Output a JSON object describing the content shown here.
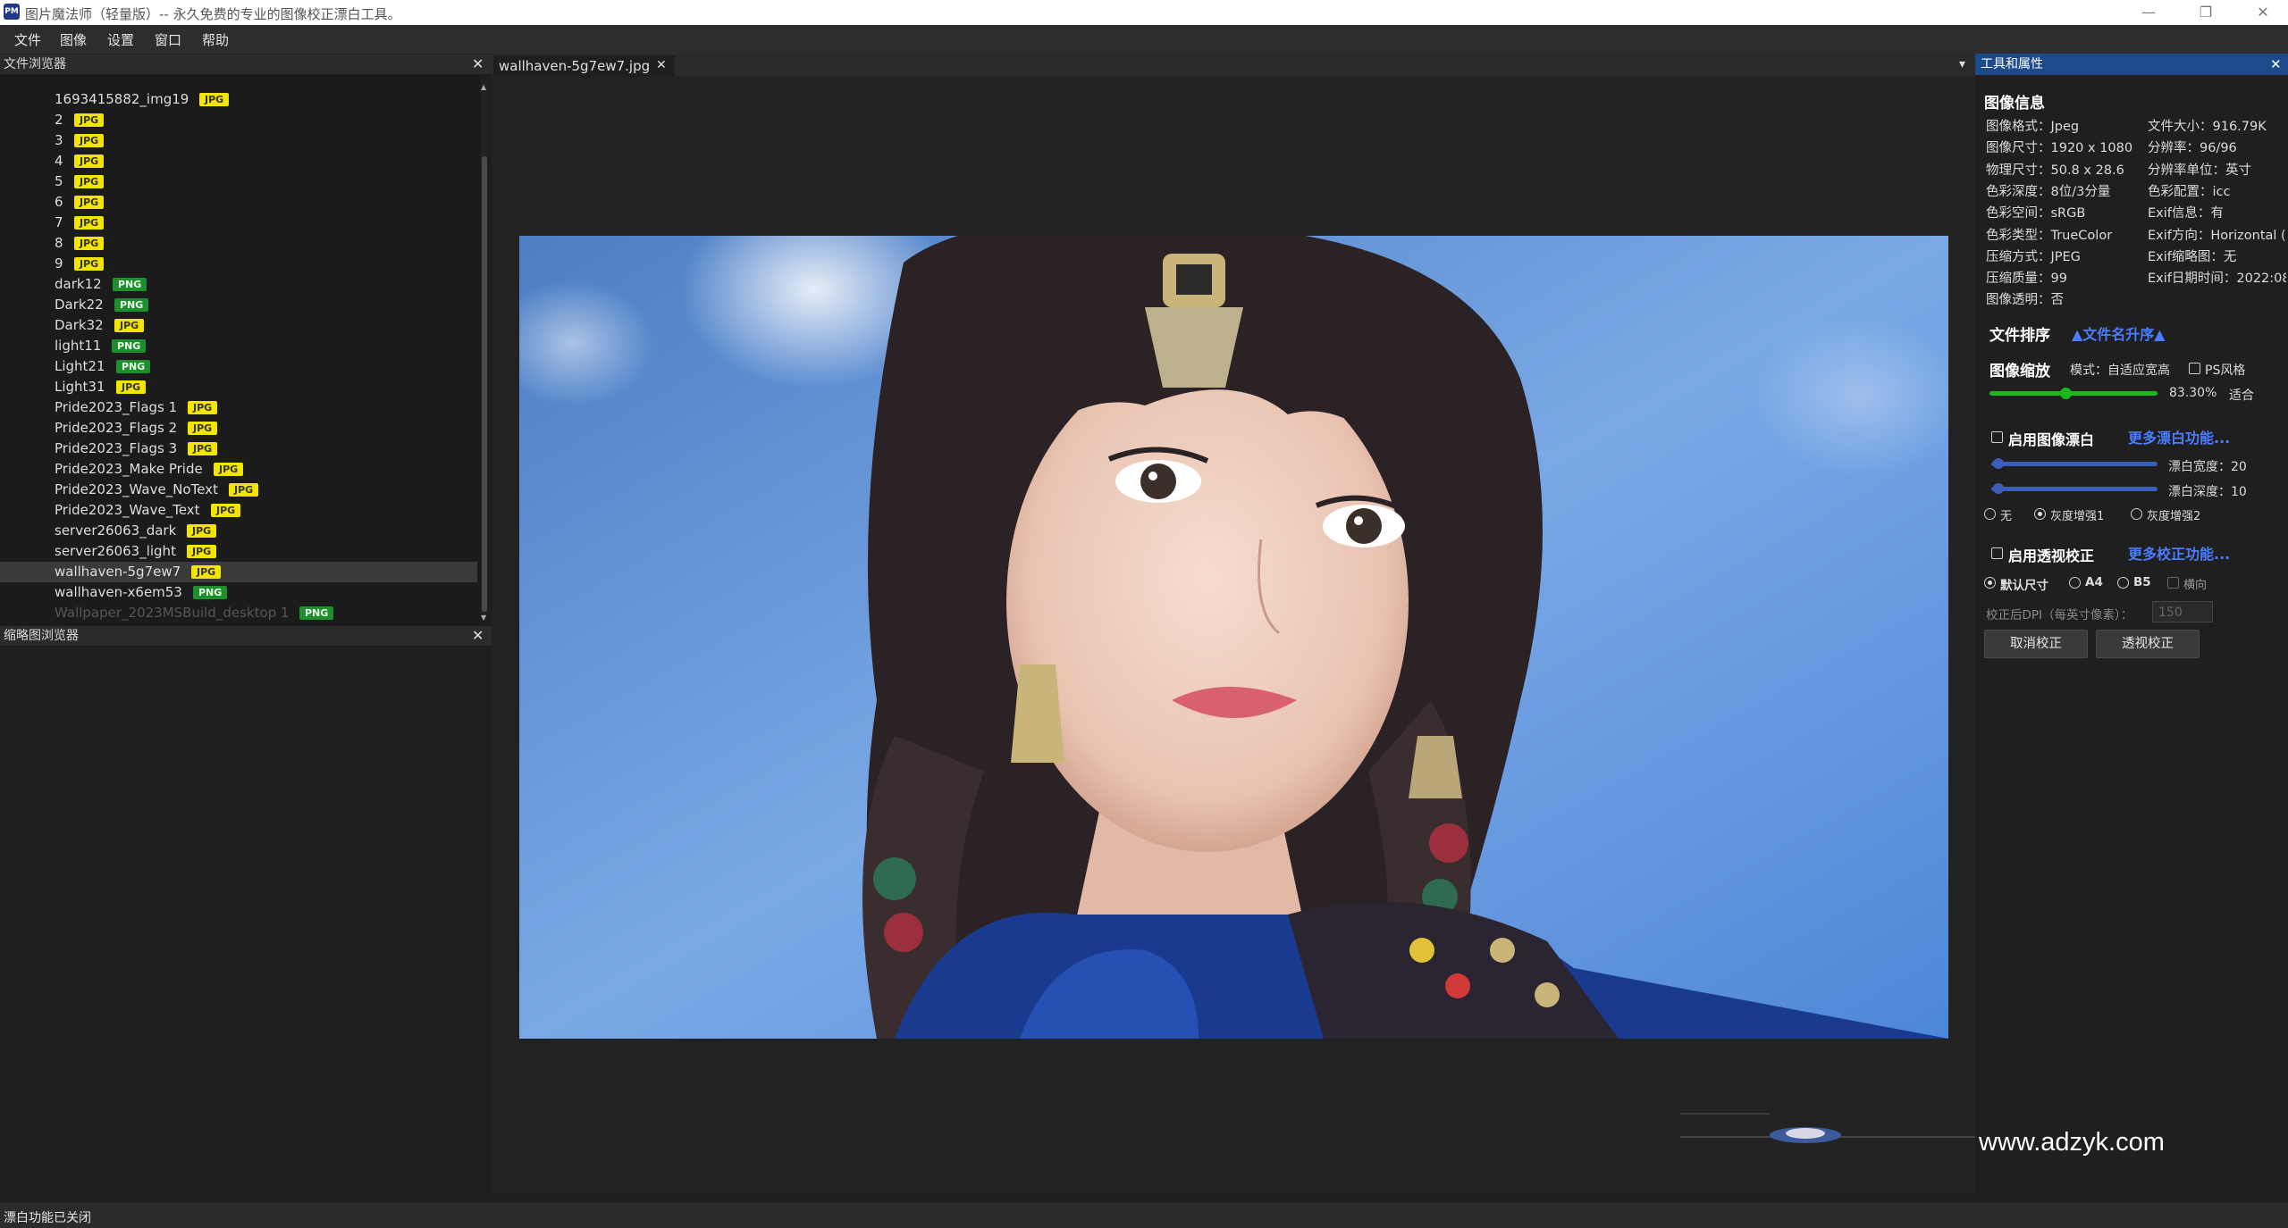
{
  "window": {
    "title": "图片魔法师（轻量版）-- 永久免费的专业的图像校正漂白工具。",
    "minimize": "—",
    "maximize": "❐",
    "close": "✕"
  },
  "menu": [
    "文件",
    "图像",
    "设置",
    "窗口",
    "帮助"
  ],
  "file_browser": {
    "title": "文件浏览器",
    "close": "✕",
    "files": [
      {
        "name": "1693415882_img19",
        "type": "JPG"
      },
      {
        "name": "2",
        "type": "JPG"
      },
      {
        "name": "3",
        "type": "JPG"
      },
      {
        "name": "4",
        "type": "JPG"
      },
      {
        "name": "5",
        "type": "JPG"
      },
      {
        "name": "6",
        "type": "JPG"
      },
      {
        "name": "7",
        "type": "JPG"
      },
      {
        "name": "8",
        "type": "JPG"
      },
      {
        "name": "9",
        "type": "JPG"
      },
      {
        "name": "dark12",
        "type": "PNG"
      },
      {
        "name": "Dark22",
        "type": "PNG"
      },
      {
        "name": "Dark32",
        "type": "JPG"
      },
      {
        "name": "light11",
        "type": "PNG"
      },
      {
        "name": "Light21",
        "type": "PNG"
      },
      {
        "name": "Light31",
        "type": "JPG"
      },
      {
        "name": "Pride2023_Flags 1",
        "type": "JPG"
      },
      {
        "name": "Pride2023_Flags 2",
        "type": "JPG"
      },
      {
        "name": "Pride2023_Flags 3",
        "type": "JPG"
      },
      {
        "name": "Pride2023_Make Pride",
        "type": "JPG"
      },
      {
        "name": "Pride2023_Wave_NoText",
        "type": "JPG"
      },
      {
        "name": "Pride2023_Wave_Text",
        "type": "JPG"
      },
      {
        "name": "server26063_dark",
        "type": "JPG"
      },
      {
        "name": "server26063_light",
        "type": "JPG"
      },
      {
        "name": "wallhaven-5g7ew7",
        "type": "JPG"
      },
      {
        "name": "wallhaven-x6em53",
        "type": "PNG"
      },
      {
        "name": "Wallpaper_2023MSBuild_desktop 1",
        "type": "PNG"
      }
    ],
    "selected_index": 23
  },
  "thumbnail_browser": {
    "title": "缩略图浏览器",
    "close": "✕"
  },
  "tab": {
    "label": "wallhaven-5g7ew7.jpg",
    "close": "✕",
    "dropdown": "▾"
  },
  "props": {
    "title": "工具和属性",
    "close": "✕",
    "image_info_title": "图像信息",
    "info_left": [
      "图像格式：Jpeg",
      "图像尺寸：1920 x 1080",
      "物理尺寸：50.8 x 28.6",
      "色彩深度：8位/3分量",
      "色彩空间：sRGB",
      "色彩类型：TrueColor",
      "压缩方式：JPEG",
      "压缩质量：99",
      "图像透明：否"
    ],
    "info_right": [
      "文件大小：916.79K",
      "分辨率：96/96",
      "分辨率单位：英寸",
      "色彩配置：icc",
      "Exif信息：有",
      "Exif方向：Horizontal (",
      "Exif缩略图：无",
      "Exif日期时间：2022:08",
      ""
    ],
    "sort_title": "文件排序",
    "sort_value": "▲文件名升序▲",
    "zoom_title": "图像缩放",
    "zoom_mode": "模式：自适应宽高",
    "ps_style": "PS风格",
    "zoom_value": "83.30%",
    "zoom_fit": "适合",
    "zoom_level": 0.45,
    "whiten_enable": "启用图像漂白",
    "whiten_more": "更多漂白功能...",
    "whiten_width_label": "漂白宽度：20",
    "whiten_depth_label": "漂白深度：10",
    "whiten_width": 0.02,
    "whiten_depth": 0.02,
    "gray_options": [
      "无",
      "灰度增强1",
      "灰度增强2"
    ],
    "gray_selected": 1,
    "persp_enable": "启用透视校正",
    "persp_more": "更多校正功能...",
    "size_options": [
      "默认尺寸",
      "A4",
      "B5"
    ],
    "landscape": "横向",
    "dpi_label": "校正后DPI（每英寸像素）：",
    "dpi_value": "150",
    "cancel_btn": "取消校正",
    "persp_btn": "透视校正"
  },
  "status": "漂白功能已关闭",
  "watermark": "www.adzyk.com",
  "colors": {
    "accent": "#1d4a8a",
    "link": "#4a7dff",
    "jpg_badge": "#f2e600",
    "png_badge": "#1e8f2e",
    "slider_green": "#1bb81b"
  }
}
